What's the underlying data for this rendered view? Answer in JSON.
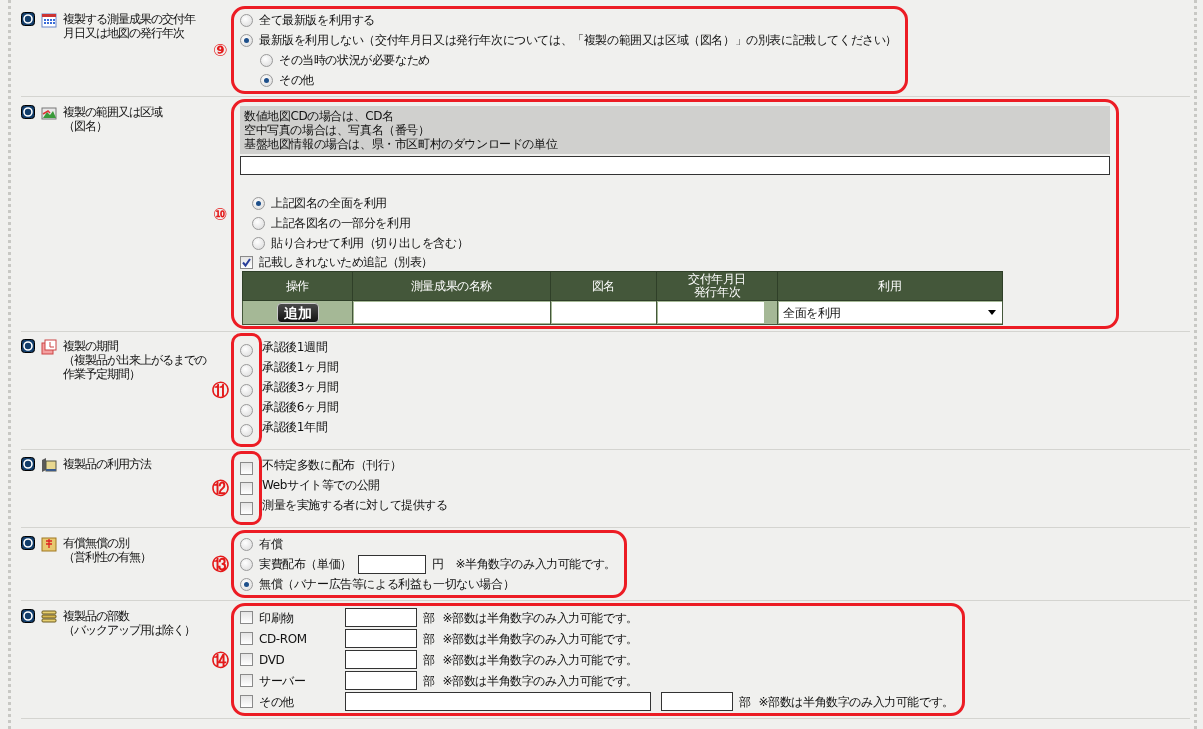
{
  "sections": [
    {
      "kind": "radio-group",
      "label_lines": [
        "複製する測量成果の交付年",
        "月日又は地図の発行年次"
      ],
      "marker": "⑨",
      "options": [
        {
          "label": "全て最新版を利用する",
          "selected": false
        },
        {
          "label": "最新版を利用しない（交付年月日又は発行年次については、「複製の範囲又は区域（図名）」の別表に記載してください）",
          "selected": true,
          "children": [
            {
              "label": "その当時の状況が必要なため",
              "selected": false
            },
            {
              "label": "その他",
              "selected": true
            }
          ]
        }
      ]
    },
    {
      "kind": "range",
      "label_lines": [
        "複製の範囲又は区域",
        "（図名）"
      ],
      "marker": "⑩",
      "hint_lines": [
        "数値地図CDの場合は、CD名",
        "空中写真の場合は、写真名（番号）",
        "基盤地図情報の場合は、県・市区町村のダウンロードの単位"
      ],
      "options": [
        {
          "label": "上記図名の全面を利用",
          "selected": true
        },
        {
          "label": "上記各図名の一部分を利用",
          "selected": false
        },
        {
          "label": "貼り合わせて利用（切り出しを含む）",
          "selected": false
        }
      ],
      "extra": {
        "label": "記載しきれないため追記（別表）",
        "checked": true
      },
      "table": {
        "columns": [
          "操作",
          "測量成果の名称",
          "図名",
          "交付年月日発行年次",
          "利用"
        ],
        "rows": [
          {
            "button": "追加",
            "select": "全面を利用"
          }
        ]
      }
    },
    {
      "kind": "radio-list",
      "label_lines": [
        "複製の期間",
        "（複製品が出来上がるまでの",
        "作業予定期間）"
      ],
      "marker": "⑪",
      "options": [
        {
          "label": "承認後1週間",
          "selected": false
        },
        {
          "label": "承認後1ヶ月間",
          "selected": false
        },
        {
          "label": "承認後3ヶ月間",
          "selected": false
        },
        {
          "label": "承認後6ヶ月間",
          "selected": false
        },
        {
          "label": "承認後1年間",
          "selected": false
        }
      ]
    },
    {
      "kind": "check-list",
      "label_lines": [
        "複製品の利用方法"
      ],
      "marker": "⑫",
      "options": [
        {
          "label": "不特定多数に配布（刊行）",
          "checked": false
        },
        {
          "label": "Webサイト等での公開",
          "checked": false
        },
        {
          "label": "測量を実施する者に対して提供する",
          "checked": false
        }
      ]
    },
    {
      "kind": "radio-group",
      "label_lines": [
        "有償無償の別",
        "（営利性の有無）"
      ],
      "marker": "⑬",
      "options": [
        {
          "label": "有償",
          "selected": false
        },
        {
          "label": "実費配布（単価）",
          "selected": false,
          "unit": "円",
          "note": "※半角数字のみ入力可能です。"
        },
        {
          "label": "無償（バナー広告等による利益も一切ない場合）",
          "selected": true
        }
      ]
    },
    {
      "kind": "quantity-list",
      "label_lines": [
        "複製品の部数",
        "（バックアップ用は除く）"
      ],
      "marker": "⑭",
      "rows": [
        {
          "kind": "count",
          "label": "印刷物",
          "checked": false,
          "unit": "部",
          "note": "※部数は半角数字のみ入力可能です。"
        },
        {
          "kind": "count",
          "label": "CD-ROM",
          "checked": false,
          "unit": "部",
          "note": "※部数は半角数字のみ入力可能です。"
        },
        {
          "kind": "count",
          "label": "DVD",
          "checked": false,
          "unit": "部",
          "note": "※部数は半角数字のみ入力可能です。"
        },
        {
          "kind": "count",
          "label": "サーバー",
          "checked": false,
          "unit": "部",
          "note": "※部数は半角数字のみ入力可能です。"
        },
        {
          "kind": "other",
          "label": "その他",
          "checked": false,
          "unit": "部",
          "note": "※部数は半角数字のみ入力可能です。"
        }
      ]
    }
  ]
}
